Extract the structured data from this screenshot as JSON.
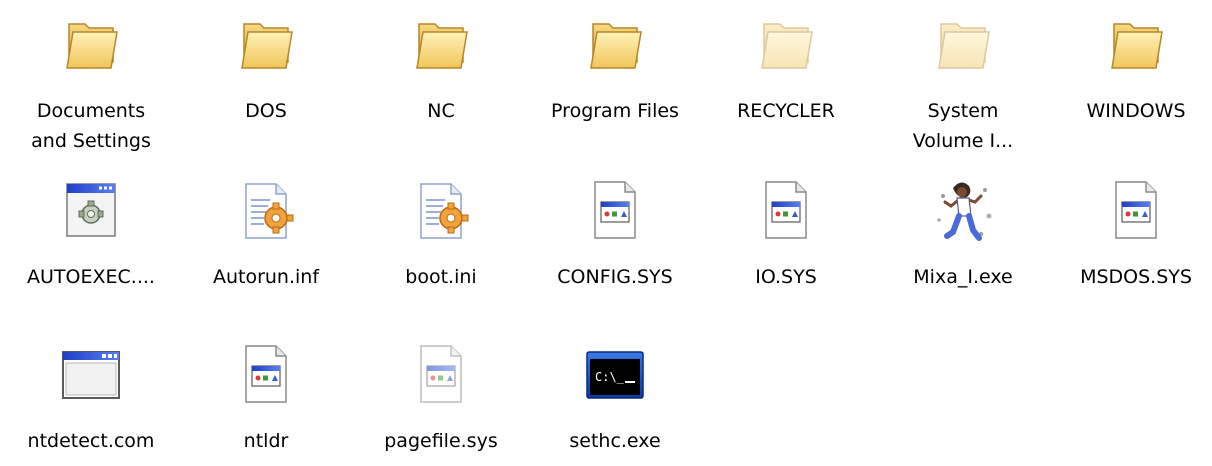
{
  "desktop": {
    "items": [
      {
        "label": "Documents\nand Settings",
        "icon": "folder-icon"
      },
      {
        "label": "DOS",
        "icon": "folder-icon"
      },
      {
        "label": "NC",
        "icon": "folder-icon"
      },
      {
        "label": "Program Files",
        "icon": "folder-icon"
      },
      {
        "label": "RECYCLER",
        "icon": "hidden-folder-icon"
      },
      {
        "label": "System\nVolume I...",
        "icon": "hidden-folder-icon"
      },
      {
        "label": "WINDOWS",
        "icon": "folder-icon"
      },
      {
        "label": "AUTOEXEC....",
        "icon": "batch-file-icon"
      },
      {
        "label": "Autorun.inf",
        "icon": "settings-file-icon"
      },
      {
        "label": "boot.ini",
        "icon": "settings-file-icon"
      },
      {
        "label": "CONFIG.SYS",
        "icon": "system-file-icon"
      },
      {
        "label": "IO.SYS",
        "icon": "system-file-icon"
      },
      {
        "label": "Mixa_I.exe",
        "icon": "dancer-program-icon"
      },
      {
        "label": "MSDOS.SYS",
        "icon": "system-file-icon"
      },
      {
        "label": "ntdetect.com",
        "icon": "application-window-icon"
      },
      {
        "label": "ntldr",
        "icon": "system-file-icon"
      },
      {
        "label": "pagefile.sys",
        "icon": "hidden-system-file-icon"
      },
      {
        "label": "sethc.exe",
        "icon": "command-prompt-icon"
      }
    ]
  },
  "colors": {
    "folder": "#f5d36e",
    "folder_dark": "#c99a2e",
    "window_title": "#2b4fd8",
    "console_bg": "#000000"
  }
}
